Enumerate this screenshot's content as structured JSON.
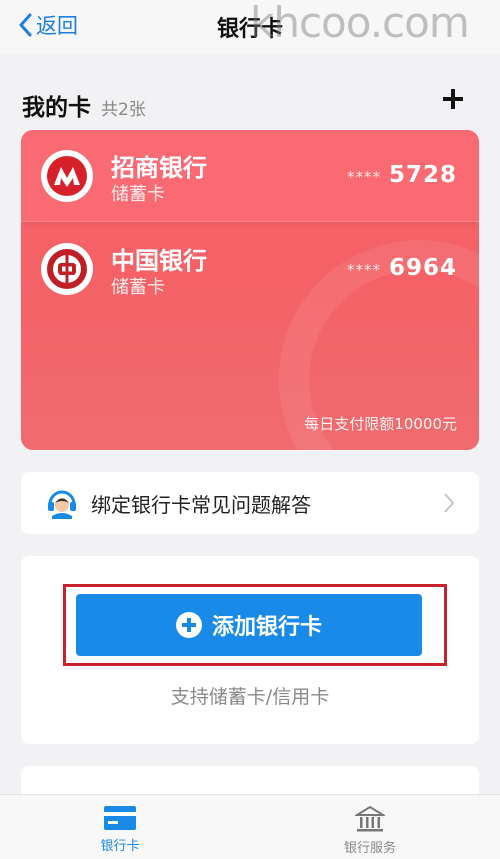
{
  "nav": {
    "back_label": "返回",
    "title": "银行卡",
    "watermark": "khcoo.com"
  },
  "section": {
    "title": "我的卡",
    "count": "共2张"
  },
  "cards": [
    {
      "bank": "招商银行",
      "type": "储蓄卡",
      "mask": "****",
      "last4": "5728",
      "icon": "cmb-logo-icon"
    },
    {
      "bank": "中国银行",
      "type": "储蓄卡",
      "mask": "****",
      "last4": "6964",
      "icon": "boc-logo-icon"
    }
  ],
  "limit_text": "每日支付限额10000元",
  "faq": {
    "label": "绑定银行卡常见问题解答",
    "icon": "customer-service-icon"
  },
  "add_card": {
    "button_label": "添加银行卡",
    "support_text": "支持储蓄卡/信用卡"
  },
  "tabbar": [
    {
      "label": "银行卡",
      "icon": "card-icon",
      "active": true
    },
    {
      "label": "银行服务",
      "icon": "bank-building-icon",
      "active": false
    }
  ],
  "colors": {
    "accent": "#1a8ae8",
    "card_red": "#f8646c",
    "highlight": "#c8232c",
    "nav_link": "#1a7fe0"
  }
}
